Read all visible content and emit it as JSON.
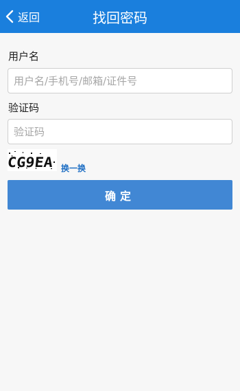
{
  "header": {
    "back_label": "返回",
    "title": "找回密码",
    "bg_color": "#1a7fdd"
  },
  "form": {
    "username": {
      "label": "用户名",
      "placeholder": "用户名/手机号/邮箱/证件号",
      "value": ""
    },
    "captcha": {
      "label": "验证码",
      "placeholder": "验证码",
      "value": "",
      "image_text": "CG9EA",
      "refresh_label": "换一换"
    },
    "confirm_label": "确定",
    "confirm_color": "#4187d4"
  },
  "icons": {
    "back": "chevron-left-icon"
  }
}
